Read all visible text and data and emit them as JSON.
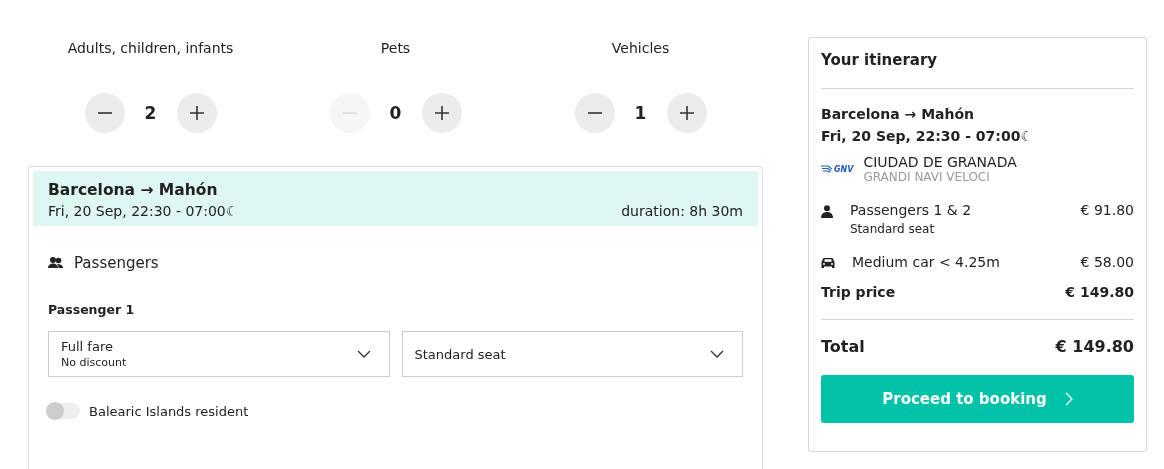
{
  "counters": [
    {
      "label": "Adults, children, infants",
      "value": "2",
      "decrement_disabled": false,
      "increment_disabled": false
    },
    {
      "label": "Pets",
      "value": "0",
      "decrement_disabled": true,
      "increment_disabled": false
    },
    {
      "label": "Vehicles",
      "value": "1",
      "decrement_disabled": false,
      "increment_disabled": false
    }
  ],
  "trip": {
    "route": "Barcelona → Mahón",
    "schedule": "Fri, 20 Sep, 22:30 - 07:00☾",
    "duration": "duration: 8h 30m",
    "section_title": "Passengers",
    "passenger_label": "Passenger 1",
    "selects": [
      {
        "value": "Full fare",
        "sub": "No discount"
      },
      {
        "value": "Standard seat"
      }
    ],
    "resident_toggle": {
      "label": "Balearic Islands resident",
      "on": false
    }
  },
  "itinerary": {
    "title": "Your itinerary",
    "route": "Barcelona → Mahón",
    "schedule": "Fri, 20 Sep, 22:30 - 07:00☾",
    "ship": {
      "logo_text": "GNV",
      "name": "CIUDAD DE GRANADA",
      "operator": "GRANDI NAVI VELOCI"
    },
    "items": [
      {
        "kind": "person",
        "label": "Passengers 1 & 2",
        "sub": "Standard seat",
        "price": "€ 91.80"
      },
      {
        "kind": "car",
        "label": "Medium car < 4.25m",
        "price": "€ 58.00"
      }
    ],
    "trip_price_label": "Trip price",
    "trip_price": "€ 149.80",
    "total_label": "Total",
    "total": "€ 149.80",
    "button": "Proceed to booking"
  }
}
